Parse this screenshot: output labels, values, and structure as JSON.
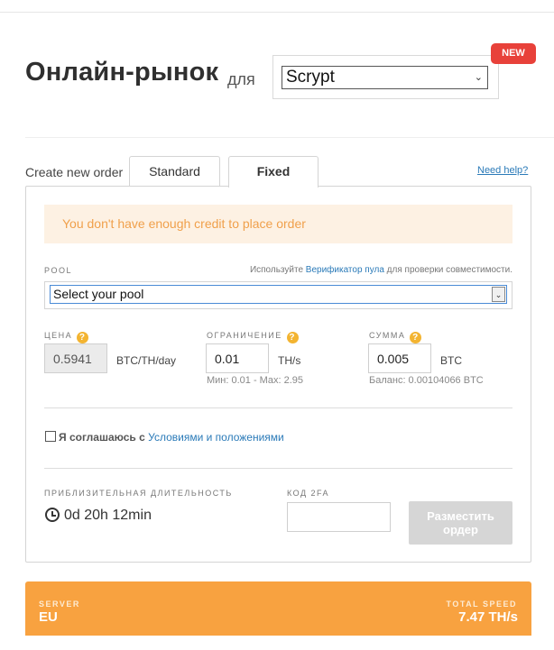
{
  "header": {
    "title": "Онлайн-рынок",
    "for_label": "для",
    "algorithm_selected": "Scrypt",
    "new_badge": "NEW"
  },
  "order": {
    "create_label": "Create new order",
    "tabs": [
      {
        "label": "Standard",
        "active": false
      },
      {
        "label": "Fixed",
        "active": true
      }
    ],
    "need_help": "Need help?",
    "alert": "You don't have enough credit to place order",
    "pool": {
      "label": "POOL",
      "hint_before": "Используйте ",
      "hint_link": "Верификатор пула",
      "hint_after": " для проверки совместимости.",
      "selected": "Select your pool"
    },
    "price": {
      "label": "ЦЕНА",
      "value": "0.5941",
      "unit": "BTC/TH/day"
    },
    "limit": {
      "label": "ОГРАНИЧЕНИЕ",
      "value": "0.01",
      "unit": "TH/s",
      "note": "Мин: 0.01 - Max: 2.95"
    },
    "amount": {
      "label": "СУММА",
      "value": "0.005",
      "unit": "BTC",
      "note": "Баланс: 0.00104066 BTC"
    },
    "agree": {
      "text": "Я соглашаюсь с ",
      "link": "Условиями и положениями",
      "checked": false
    },
    "duration": {
      "label": "ПРИБЛИЗИТЕЛЬНАЯ ДЛИТЕЛЬНОСТЬ",
      "value": "0d 20h 12min"
    },
    "tfa": {
      "label": "КОД 2FA",
      "value": ""
    },
    "place_button": "Разместить ордер"
  },
  "server": {
    "label": "SERVER",
    "value": "EU",
    "speed_label": "TOTAL SPEED",
    "speed_value": "7.47 TH/s"
  },
  "colors": {
    "accent_orange": "#f8a240",
    "new_badge": "#e8413a",
    "link_blue": "#2a7ab8",
    "alert_bg": "#fdf1e3",
    "alert_text": "#f0a04b"
  }
}
